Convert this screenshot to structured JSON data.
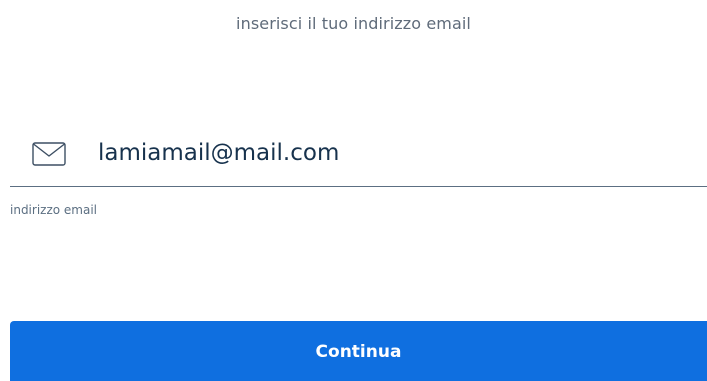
{
  "instruction": "inserisci il tuo indirizzo email",
  "email_field": {
    "icon": "envelope-icon",
    "value": "lamiamail@mail.com",
    "label": "indirizzo email"
  },
  "continue_button": {
    "label": "Continua"
  },
  "colors": {
    "accent": "#0f6fe0",
    "text": "#17324d",
    "muted": "#5c6f82"
  }
}
